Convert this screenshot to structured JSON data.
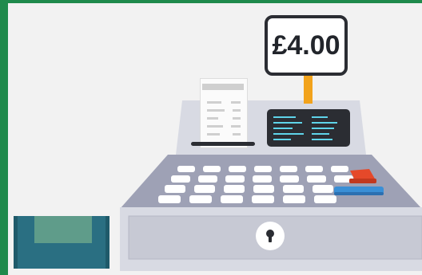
{
  "price_sign": {
    "price": "£4.00"
  },
  "colors": {
    "border_green": "#1f8a4c",
    "background": "#f2f2f2",
    "register_top": "#d8dae3",
    "register_body": "#9ea1b5",
    "drawer": "#c7c9d4",
    "screen": "#2b2d33",
    "screen_lines": "#5fd4ea",
    "sign_post": "#f2a31c",
    "red_key": "#e5492a",
    "blue_key": "#3a8fd6",
    "cash_box": "#2a6f82",
    "cash_box_lid": "#5f9c8a"
  },
  "icons": {
    "keyhole": "keyhole-icon",
    "receipt": "receipt-icon",
    "register": "cash-register-icon"
  }
}
